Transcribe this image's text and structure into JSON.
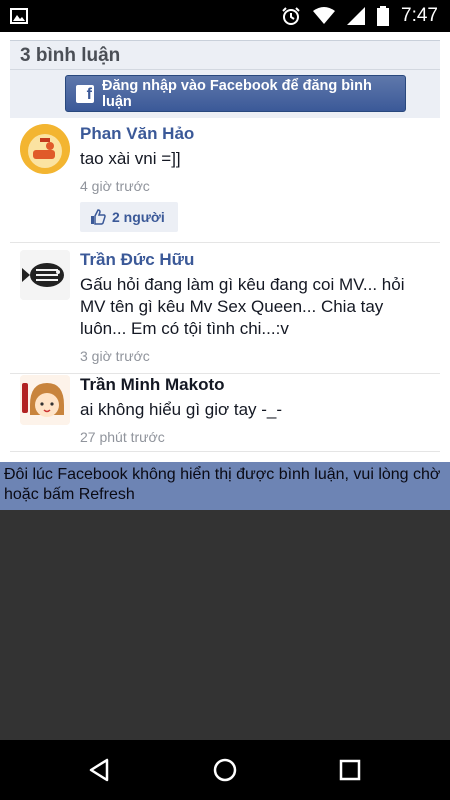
{
  "status_bar": {
    "time": "7:47",
    "icons": [
      "gallery-icon",
      "alarm-clock-icon",
      "wifi-icon",
      "cell-signal-icon",
      "battery-icon"
    ]
  },
  "comments_header": {
    "count_label": "3 bình luận",
    "login_button_label": "Đăng nhập vào Facebook để đăng bình luận"
  },
  "comments": [
    {
      "author": "Phan Văn Hảo",
      "text": "tao xài vni =]]",
      "time": "4 giờ trước",
      "likes": "2 người"
    },
    {
      "author": "Trần Đức Hữu",
      "text": "Gấu hỏi đang làm gì kêu đang coi MV... hỏi MV tên gì kêu Mv Sex Queen... Chia tay luôn... Em có tội tình chi...:v",
      "time": "3 giờ trước"
    },
    {
      "author": "Trần Minh Makoto",
      "text": "ai không hiểu gì giơ tay -_-",
      "time": "27 phút trước"
    }
  ],
  "notice": "Đôi lúc Facebook không hiển thị được bình luận, vui lòng chờ hoặc bấm Refresh",
  "colors": {
    "facebook_blue": "#3b5998",
    "notice_bg": "#6d84b4",
    "empty_area_bg": "#333333"
  },
  "nav_bar": {
    "icons": [
      "back-icon",
      "home-icon",
      "recents-icon"
    ]
  }
}
